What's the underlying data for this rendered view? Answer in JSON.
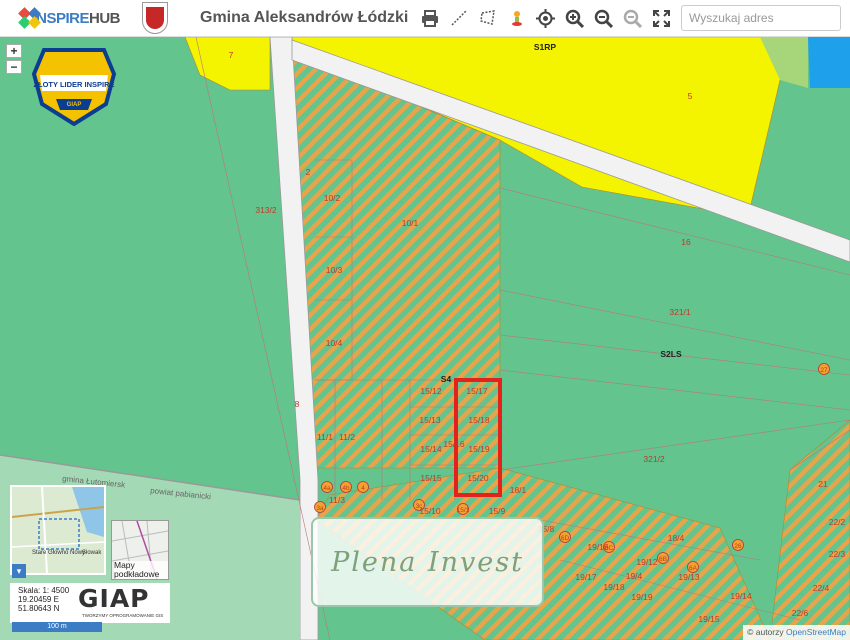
{
  "header": {
    "logo_prefix": "INSPIRE",
    "logo_suffix": "HUB",
    "title": "Gmina Aleksandrów Łódzki",
    "search_placeholder": "Wyszukaj adres",
    "tools": [
      "print-icon",
      "measure-line-icon",
      "measure-area-icon",
      "street-view-icon",
      "locate-icon",
      "zoom-in-icon",
      "zoom-out-icon",
      "fullscreen-icon"
    ]
  },
  "map": {
    "zoom_in": "+",
    "zoom_out": "−",
    "badge_title": "ZŁOTY LIDER INSPIRE",
    "badge_sub": "GIAP",
    "parcel_labels": [
      "7",
      "S1RP",
      "5",
      "2",
      "313/2",
      "10/2",
      "10/1",
      "16",
      "10/3",
      "321/1",
      "S2LS",
      "10/4",
      "27",
      "S4",
      "15/12",
      "15/17",
      "8",
      "15/13",
      "15/18",
      "11/1",
      "11/2",
      "15/14",
      "15/16",
      "15/19",
      "321/2",
      "15/15",
      "15/20",
      "18/1",
      "4a",
      "4b",
      "4",
      "11/3",
      "21",
      "3a",
      "3c",
      "15/10",
      "15/1",
      "15/9",
      "22/2",
      "18/4",
      "26",
      "6D",
      "6C",
      "6B",
      "19/16",
      "19/12",
      "19/13",
      "6A",
      "19/17",
      "19/4",
      "22/3",
      "19/18",
      "19/19",
      "22/4",
      "19/14",
      "19/15",
      "22/6",
      "15/8"
    ],
    "minimap_labels": [
      "Stare Głowno Nowy",
      "Słowak"
    ],
    "basemaps_label": "Mapy podkładowe",
    "scale_line1": "Skala: 1: 4500",
    "scale_line2": "19.20459 E",
    "scale_line3": "51.80643 N",
    "giap_logo": "GIAP",
    "giap_sub": "TWORZYMY OPROGRAMOWANIE GIS",
    "scalebar": "100 m",
    "brand_overlay": "Plena Invest",
    "attribution_prefix": "© autorzy",
    "attribution_link": "OpenStreetMap",
    "road_label": "gmina Łutomiersk",
    "road_label2": "powiat pabianicki"
  },
  "colors": {
    "forest_green": "#63c48e",
    "yellow": "#f4f400",
    "stripe_orange": "#e8a44a",
    "highlight_red": "#e3231b",
    "water": "#1ea0ea",
    "parcel_label": "#c0392b"
  }
}
